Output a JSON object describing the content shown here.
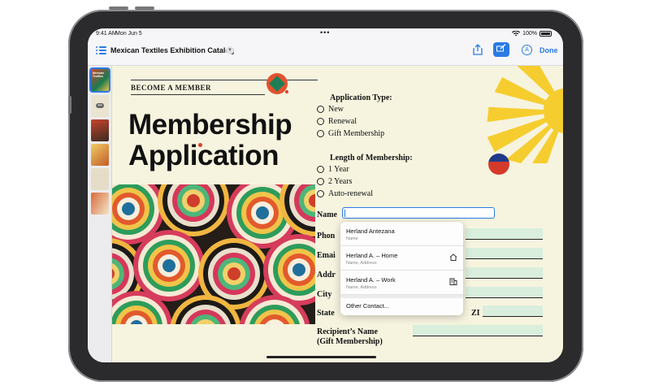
{
  "status_bar": {
    "time": "9:41 AM",
    "date": "Mon Jun 5",
    "multitask_dots": "•••",
    "battery_level": "100%"
  },
  "toolbar": {
    "document_title": "Mexican Textiles Exhibition Catalog",
    "done_label": "Done"
  },
  "thumbnails": {
    "first_title": "Mexican Textiles"
  },
  "page": {
    "kicker": "BECOME A MEMBER",
    "hero_line1": "Membership",
    "hero_line2": "Application"
  },
  "form": {
    "application_type": {
      "heading": "Application Type:",
      "options": [
        "New",
        "Renewal",
        "Gift Membership"
      ]
    },
    "length": {
      "heading": "Length of Membership:",
      "options": [
        "1 Year",
        "2 Years",
        "Auto-renewal"
      ]
    },
    "fields": {
      "name": "Name",
      "phone": "Phon",
      "email": "Emai",
      "address": "Addr",
      "city": "City",
      "state": "State",
      "zip": "ZI",
      "recipient_line1": "Recipient’s Name",
      "recipient_line2": "(Gift Membership)"
    }
  },
  "autofill": {
    "items": [
      {
        "title": "Herland Antezana",
        "subtitle": "Name",
        "icon": ""
      },
      {
        "title": "Herland A. – Home",
        "subtitle": "Name, Address",
        "icon": "house-icon"
      },
      {
        "title": "Herland A. – Work",
        "subtitle": "Name, Address",
        "icon": "building-icon"
      }
    ],
    "other": "Other Contact..."
  },
  "colors": {
    "accent": "#2a7ae4",
    "sun": "#f6cd2f",
    "field_fill": "#d9eedc"
  }
}
